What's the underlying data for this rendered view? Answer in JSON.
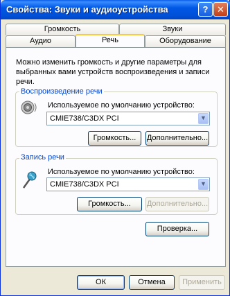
{
  "window": {
    "title": "Свойства: Звуки и аудиоустройства",
    "help": "?",
    "close": "✕"
  },
  "tabs": {
    "row1": [
      "Громкость",
      "Звуки"
    ],
    "row2": [
      "Аудио",
      "Речь",
      "Оборудование"
    ],
    "active": "Речь"
  },
  "description": "Можно изменить громкость и другие параметры для выбранных вами устройств воспроизведения и записи речи.",
  "playback": {
    "title": "Воспроизведение речи",
    "device_label": "Используемое по умолчанию устройство:",
    "device": "CMIE738/C3DX PCI",
    "volume_button": "Громкость...",
    "advanced_button": "Дополнительно..."
  },
  "recording": {
    "title": "Запись речи",
    "device_label": "Используемое по умолчанию устройство:",
    "device": "CMIE738/C3DX PCI",
    "volume_button": "Громкость...",
    "advanced_button": "Дополнительно..."
  },
  "test_button": "Проверка...",
  "footer": {
    "ok": "ОК",
    "cancel": "Отмена",
    "apply": "Применить"
  }
}
